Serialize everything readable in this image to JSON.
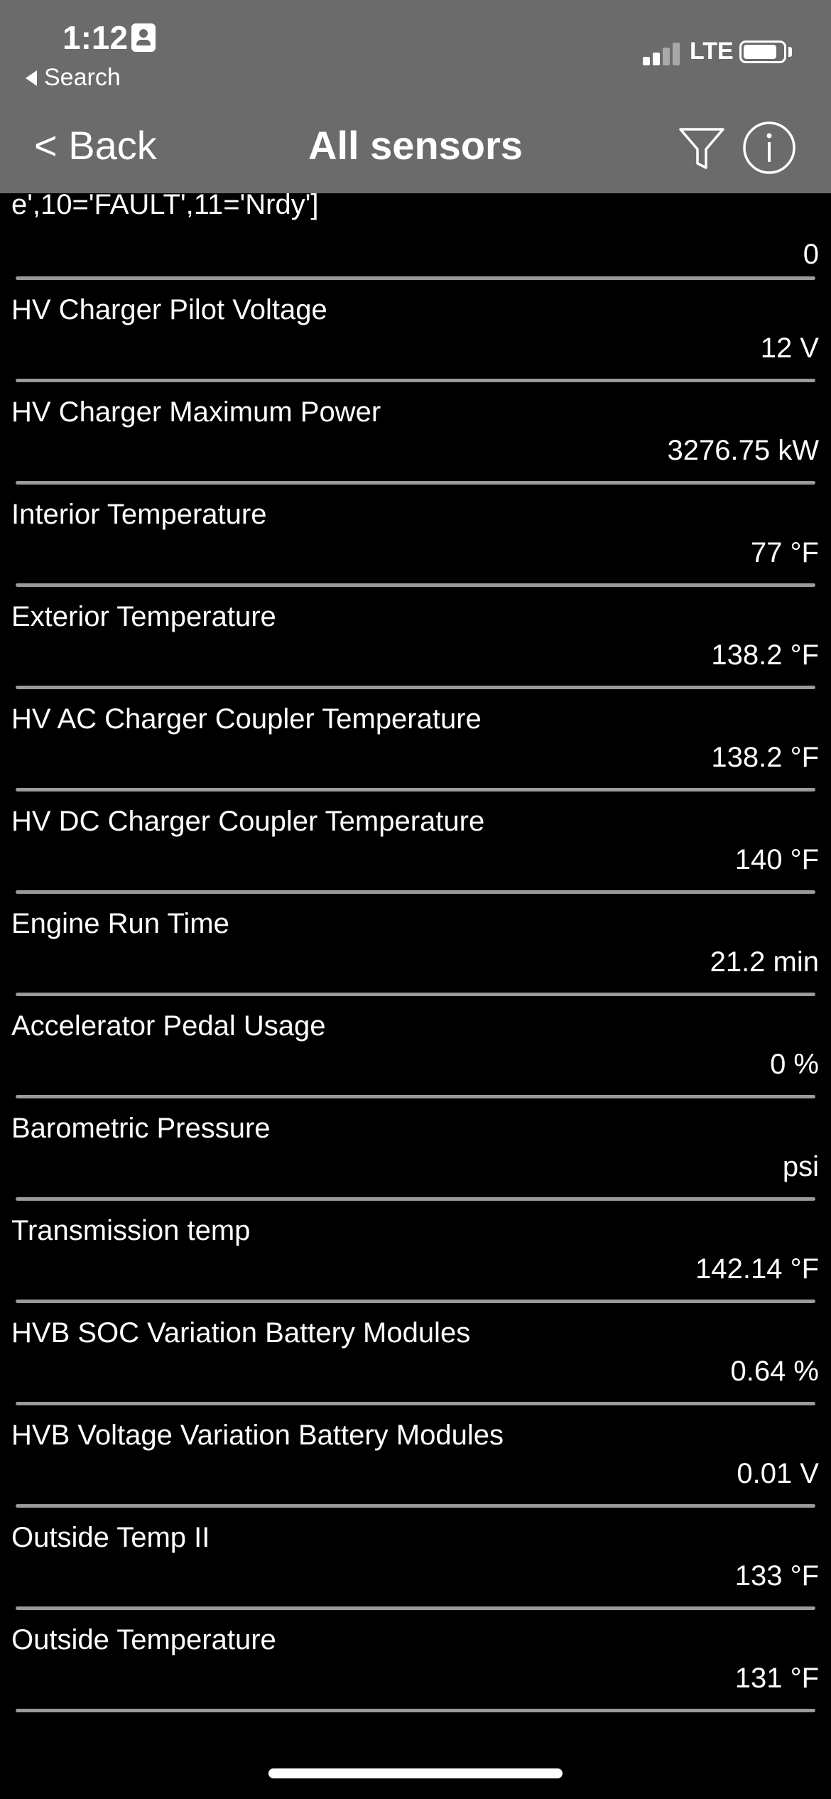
{
  "status_bar": {
    "time": "1:12",
    "back_label": "Search",
    "network": "LTE",
    "signal_bars_active": 2,
    "signal_bars_total": 4,
    "battery_level": 0.85
  },
  "nav": {
    "back_label": "< Back",
    "title": "All sensors",
    "filter_icon": "filter-icon",
    "info_icon": "info-icon"
  },
  "sensors": [
    {
      "label": "e',10='FAULT',11='Nrdy']",
      "value": "0"
    },
    {
      "label": "HV Charger Pilot Voltage",
      "value": "12 V"
    },
    {
      "label": "HV Charger Maximum Power",
      "value": "3276.75 kW"
    },
    {
      "label": "Interior Temperature",
      "value": "77 °F"
    },
    {
      "label": "Exterior Temperature",
      "value": "138.2 °F"
    },
    {
      "label": "HV AC Charger Coupler Temperature",
      "value": "138.2 °F"
    },
    {
      "label": "HV DC Charger Coupler Temperature",
      "value": "140 °F"
    },
    {
      "label": "Engine Run Time",
      "value": "21.2 min"
    },
    {
      "label": "Accelerator Pedal Usage",
      "value": "0 %"
    },
    {
      "label": "Barometric Pressure",
      "value": "psi"
    },
    {
      "label": "Transmission temp",
      "value": "142.14 °F"
    },
    {
      "label": "HVB SOC Variation Battery Modules",
      "value": "0.64 %"
    },
    {
      "label": "HVB Voltage Variation Battery Modules",
      "value": "0.01 V"
    },
    {
      "label": "Outside Temp II",
      "value": "133 °F"
    },
    {
      "label": "Outside Temperature",
      "value": "131 °F"
    }
  ],
  "colors": {
    "header_bg": "#6b6b6b",
    "list_bg": "#000000",
    "divider": "#9a9a9a",
    "text": "#ffffff",
    "signal_inactive": "#a8a8a8"
  }
}
